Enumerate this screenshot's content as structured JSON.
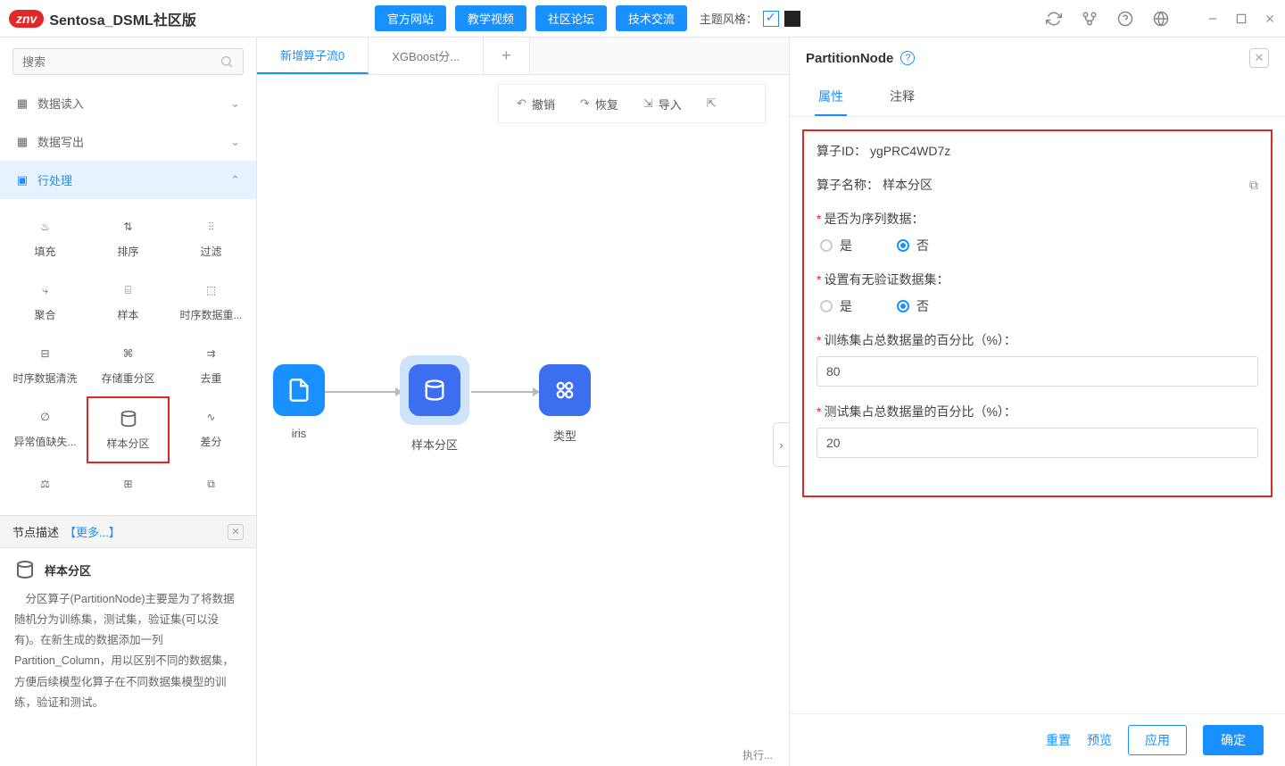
{
  "titlebar": {
    "logo_badge": "znv",
    "product": "Sentosa_DSML社区版",
    "nav": [
      "官方网站",
      "教学视频",
      "社区论坛",
      "技术交流"
    ],
    "theme_label": "主题风格："
  },
  "sidebar": {
    "search_placeholder": "搜索",
    "categories": [
      {
        "label": "数据读入",
        "expanded": false
      },
      {
        "label": "数据写出",
        "expanded": false
      },
      {
        "label": "行处理",
        "expanded": true
      }
    ],
    "operators": [
      "填充",
      "排序",
      "过滤",
      "聚合",
      "样本",
      "时序数据重...",
      "时序数据清洗",
      "存储重分区",
      "去重",
      "异常值缺失...",
      "样本分区",
      "差分"
    ],
    "selected_op_index": 10,
    "desc": {
      "head": "节点描述",
      "more": "【更多...】",
      "title": "样本分区",
      "text": "分区算子(PartitionNode)主要是为了将数据随机分为训练集，测试集，验证集(可以没有)。在新生成的数据添加一列Partition_Column，用以区别不同的数据集，方便后续模型化算子在不同数据集模型的训练，验证和测试。"
    }
  },
  "tabs": {
    "items": [
      {
        "label": "新增算子流0",
        "active": true
      },
      {
        "label": "XGBoost分...",
        "active": false
      }
    ]
  },
  "toolbar": {
    "undo": "撤销",
    "redo": "恢复",
    "import": "导入"
  },
  "canvas": {
    "nodes": [
      {
        "id": "iris",
        "label": "iris"
      },
      {
        "id": "partition",
        "label": "样本分区"
      },
      {
        "id": "type",
        "label": "类型"
      }
    ]
  },
  "status": "执行...",
  "props": {
    "title": "PartitionNode",
    "tabs": {
      "attr": "属性",
      "note": "注释"
    },
    "id_label": "算子ID：",
    "id_value": "ygPRC4WD7z",
    "name_label": "算子名称：",
    "name_value": "样本分区",
    "seq_label": "是否为序列数据：",
    "val_label": "设置有无验证数据集：",
    "yes": "是",
    "no": "否",
    "train_label": "训练集占总数据量的百分比（%）：",
    "train_value": "80",
    "test_label": "测试集占总数据量的百分比（%）：",
    "test_value": "20",
    "footer": {
      "reset": "重置",
      "preview": "预览",
      "apply": "应用",
      "ok": "确定"
    }
  }
}
